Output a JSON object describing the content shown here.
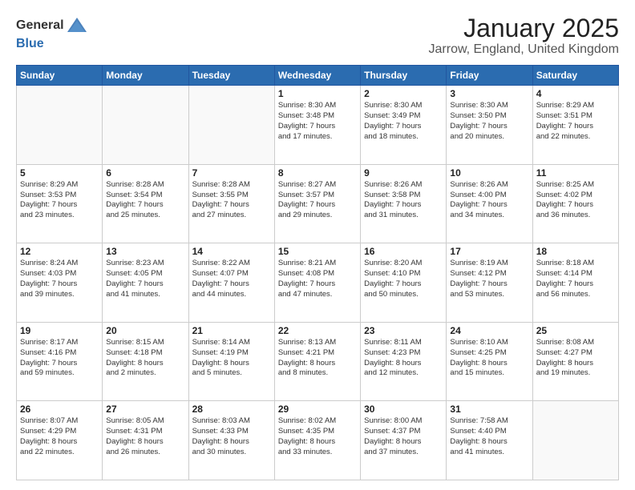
{
  "header": {
    "logo_general": "General",
    "logo_blue": "Blue",
    "title": "January 2025",
    "subtitle": "Jarrow, England, United Kingdom"
  },
  "days_of_week": [
    "Sunday",
    "Monday",
    "Tuesday",
    "Wednesday",
    "Thursday",
    "Friday",
    "Saturday"
  ],
  "weeks": [
    [
      {
        "day": "",
        "info": ""
      },
      {
        "day": "",
        "info": ""
      },
      {
        "day": "",
        "info": ""
      },
      {
        "day": "1",
        "info": "Sunrise: 8:30 AM\nSunset: 3:48 PM\nDaylight: 7 hours\nand 17 minutes."
      },
      {
        "day": "2",
        "info": "Sunrise: 8:30 AM\nSunset: 3:49 PM\nDaylight: 7 hours\nand 18 minutes."
      },
      {
        "day": "3",
        "info": "Sunrise: 8:30 AM\nSunset: 3:50 PM\nDaylight: 7 hours\nand 20 minutes."
      },
      {
        "day": "4",
        "info": "Sunrise: 8:29 AM\nSunset: 3:51 PM\nDaylight: 7 hours\nand 22 minutes."
      }
    ],
    [
      {
        "day": "5",
        "info": "Sunrise: 8:29 AM\nSunset: 3:53 PM\nDaylight: 7 hours\nand 23 minutes."
      },
      {
        "day": "6",
        "info": "Sunrise: 8:28 AM\nSunset: 3:54 PM\nDaylight: 7 hours\nand 25 minutes."
      },
      {
        "day": "7",
        "info": "Sunrise: 8:28 AM\nSunset: 3:55 PM\nDaylight: 7 hours\nand 27 minutes."
      },
      {
        "day": "8",
        "info": "Sunrise: 8:27 AM\nSunset: 3:57 PM\nDaylight: 7 hours\nand 29 minutes."
      },
      {
        "day": "9",
        "info": "Sunrise: 8:26 AM\nSunset: 3:58 PM\nDaylight: 7 hours\nand 31 minutes."
      },
      {
        "day": "10",
        "info": "Sunrise: 8:26 AM\nSunset: 4:00 PM\nDaylight: 7 hours\nand 34 minutes."
      },
      {
        "day": "11",
        "info": "Sunrise: 8:25 AM\nSunset: 4:02 PM\nDaylight: 7 hours\nand 36 minutes."
      }
    ],
    [
      {
        "day": "12",
        "info": "Sunrise: 8:24 AM\nSunset: 4:03 PM\nDaylight: 7 hours\nand 39 minutes."
      },
      {
        "day": "13",
        "info": "Sunrise: 8:23 AM\nSunset: 4:05 PM\nDaylight: 7 hours\nand 41 minutes."
      },
      {
        "day": "14",
        "info": "Sunrise: 8:22 AM\nSunset: 4:07 PM\nDaylight: 7 hours\nand 44 minutes."
      },
      {
        "day": "15",
        "info": "Sunrise: 8:21 AM\nSunset: 4:08 PM\nDaylight: 7 hours\nand 47 minutes."
      },
      {
        "day": "16",
        "info": "Sunrise: 8:20 AM\nSunset: 4:10 PM\nDaylight: 7 hours\nand 50 minutes."
      },
      {
        "day": "17",
        "info": "Sunrise: 8:19 AM\nSunset: 4:12 PM\nDaylight: 7 hours\nand 53 minutes."
      },
      {
        "day": "18",
        "info": "Sunrise: 8:18 AM\nSunset: 4:14 PM\nDaylight: 7 hours\nand 56 minutes."
      }
    ],
    [
      {
        "day": "19",
        "info": "Sunrise: 8:17 AM\nSunset: 4:16 PM\nDaylight: 7 hours\nand 59 minutes."
      },
      {
        "day": "20",
        "info": "Sunrise: 8:15 AM\nSunset: 4:18 PM\nDaylight: 8 hours\nand 2 minutes."
      },
      {
        "day": "21",
        "info": "Sunrise: 8:14 AM\nSunset: 4:19 PM\nDaylight: 8 hours\nand 5 minutes."
      },
      {
        "day": "22",
        "info": "Sunrise: 8:13 AM\nSunset: 4:21 PM\nDaylight: 8 hours\nand 8 minutes."
      },
      {
        "day": "23",
        "info": "Sunrise: 8:11 AM\nSunset: 4:23 PM\nDaylight: 8 hours\nand 12 minutes."
      },
      {
        "day": "24",
        "info": "Sunrise: 8:10 AM\nSunset: 4:25 PM\nDaylight: 8 hours\nand 15 minutes."
      },
      {
        "day": "25",
        "info": "Sunrise: 8:08 AM\nSunset: 4:27 PM\nDaylight: 8 hours\nand 19 minutes."
      }
    ],
    [
      {
        "day": "26",
        "info": "Sunrise: 8:07 AM\nSunset: 4:29 PM\nDaylight: 8 hours\nand 22 minutes."
      },
      {
        "day": "27",
        "info": "Sunrise: 8:05 AM\nSunset: 4:31 PM\nDaylight: 8 hours\nand 26 minutes."
      },
      {
        "day": "28",
        "info": "Sunrise: 8:03 AM\nSunset: 4:33 PM\nDaylight: 8 hours\nand 30 minutes."
      },
      {
        "day": "29",
        "info": "Sunrise: 8:02 AM\nSunset: 4:35 PM\nDaylight: 8 hours\nand 33 minutes."
      },
      {
        "day": "30",
        "info": "Sunrise: 8:00 AM\nSunset: 4:37 PM\nDaylight: 8 hours\nand 37 minutes."
      },
      {
        "day": "31",
        "info": "Sunrise: 7:58 AM\nSunset: 4:40 PM\nDaylight: 8 hours\nand 41 minutes."
      },
      {
        "day": "",
        "info": ""
      }
    ]
  ]
}
